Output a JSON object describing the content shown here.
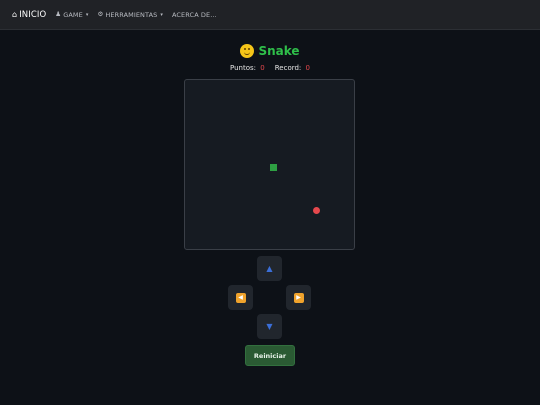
{
  "navbar": {
    "brand_icon": "home-icon",
    "brand_label": "INICIO",
    "items": [
      {
        "icon": "gamepad-icon",
        "label": "GAME",
        "dropdown": true
      },
      {
        "icon": "gear-icon",
        "label": "HERRAMIENTAS",
        "dropdown": true
      },
      {
        "label": "ACERCA DE...",
        "dropdown": false
      }
    ]
  },
  "game": {
    "title_icon": "money-mouth-face-emoji",
    "title": "Snake",
    "score_label": "Puntos:",
    "score_value": "0",
    "record_label": "Record:",
    "record_value": "0",
    "snake_color": "#2ea043",
    "food_color": "#e5484d"
  },
  "controls": {
    "up": "▲",
    "left": "◀",
    "right": "▶",
    "down": "▼",
    "restart_label": "Reiniciar"
  },
  "colors": {
    "background": "#0d1117",
    "navbar": "#202226",
    "title": "#2fbf4a",
    "score_value": "#e5484d",
    "board": "#161b22",
    "restart_button": "#2a5a33"
  }
}
